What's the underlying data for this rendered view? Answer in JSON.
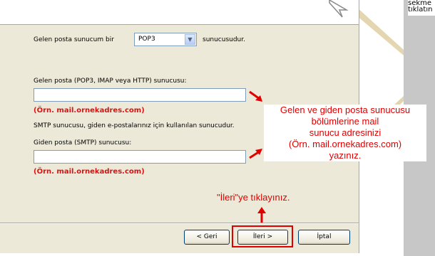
{
  "corner": {
    "line1": "sekme",
    "line2": "tıklatın"
  },
  "form": {
    "incoming_type_prefix": "Gelen posta sunucum bir",
    "incoming_type_value": "POP3",
    "incoming_type_suffix": "sunucusudur.",
    "incoming_server_label": "Gelen posta (POP3, IMAP veya HTTP) sunucusu:",
    "incoming_server_value": "",
    "incoming_example": "(Örn. mail.ornekadres.com)",
    "smtp_description": "SMTP sunucusu, giden e-postalarınız için kullanılan sunucudur.",
    "outgoing_server_label": "Giden posta (SMTP) sunucusu:",
    "outgoing_server_value": "",
    "outgoing_example": "(Örn. mail.ornekadres.com)"
  },
  "callout": {
    "line1": "Gelen ve giden posta sunucusu",
    "line2": "bölümlerine mail",
    "line3": "sunucu adresinizi",
    "line4": "(Örn. mail.ornekadres.com)",
    "line5": "yazınız."
  },
  "next_hint": "\"İleri\"ye tıklayınız.",
  "buttons": {
    "back": "< Geri",
    "next": "İleri >",
    "cancel": "İptal"
  },
  "colors": {
    "annotation": "#e00000",
    "dialog_bg": "#ece9d8",
    "input_border": "#7f9db9"
  },
  "icons": [
    "mouse-cursor-icon",
    "dropdown-arrow-icon",
    "red-arrow-icon"
  ]
}
